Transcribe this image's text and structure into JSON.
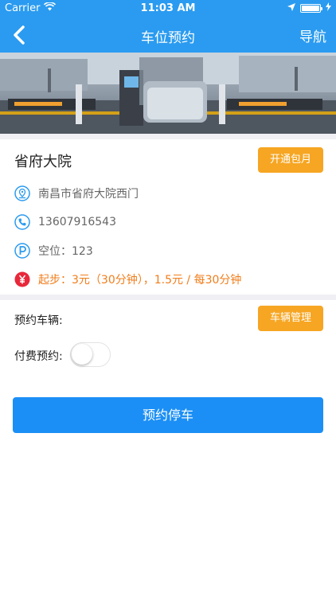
{
  "status_bar": {
    "carrier": "Carrier",
    "time": "11:03 AM"
  },
  "nav": {
    "title": "车位预约",
    "right_label": "导航"
  },
  "lot": {
    "name": "省府大院",
    "monthly_button": "开通包月",
    "address": "南昌市省府大院西门",
    "phone": "13607916543",
    "spaces": "空位：123",
    "price": "起步：3元（30分钟），1.5元 / 每30分钟"
  },
  "form": {
    "vehicle_label": "预约车辆:",
    "vehicle_button": "车辆管理",
    "paid_label": "付费预约:",
    "paid_enabled": false
  },
  "submit_label": "预约停车",
  "colors": {
    "primary": "#2a9bf0",
    "accent": "#f6a623",
    "price": "#f07d1b",
    "button": "#1b8ff6"
  }
}
